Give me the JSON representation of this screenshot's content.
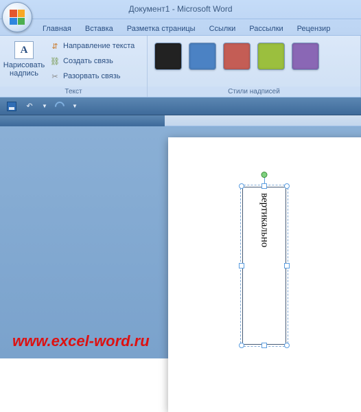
{
  "titlebar": {
    "title": "Документ1 - Microsoft Word"
  },
  "tabs": {
    "home": "Главная",
    "insert": "Вставка",
    "pagelayout": "Разметка страницы",
    "references": "Ссылки",
    "mailings": "Рассылки",
    "review": "Рецензир"
  },
  "ribbon": {
    "text_group": {
      "draw_textbox": "Нарисовать надпись",
      "text_direction": "Направление текста",
      "create_link": "Создать связь",
      "break_link": "Разорвать связь",
      "label": "Текст"
    },
    "styles_group": {
      "label": "Стили надписей",
      "colors": {
        "black": "#222222",
        "blue": "#4b82c4",
        "red": "#c45d55",
        "green": "#9bbf3e",
        "purple": "#8a67b5"
      }
    }
  },
  "qat": {
    "save": "Сохранить",
    "undo": "Отменить",
    "redo": "Повторить"
  },
  "document": {
    "textbox_content": "вертикально"
  },
  "watermark": "www.excel-word.ru"
}
